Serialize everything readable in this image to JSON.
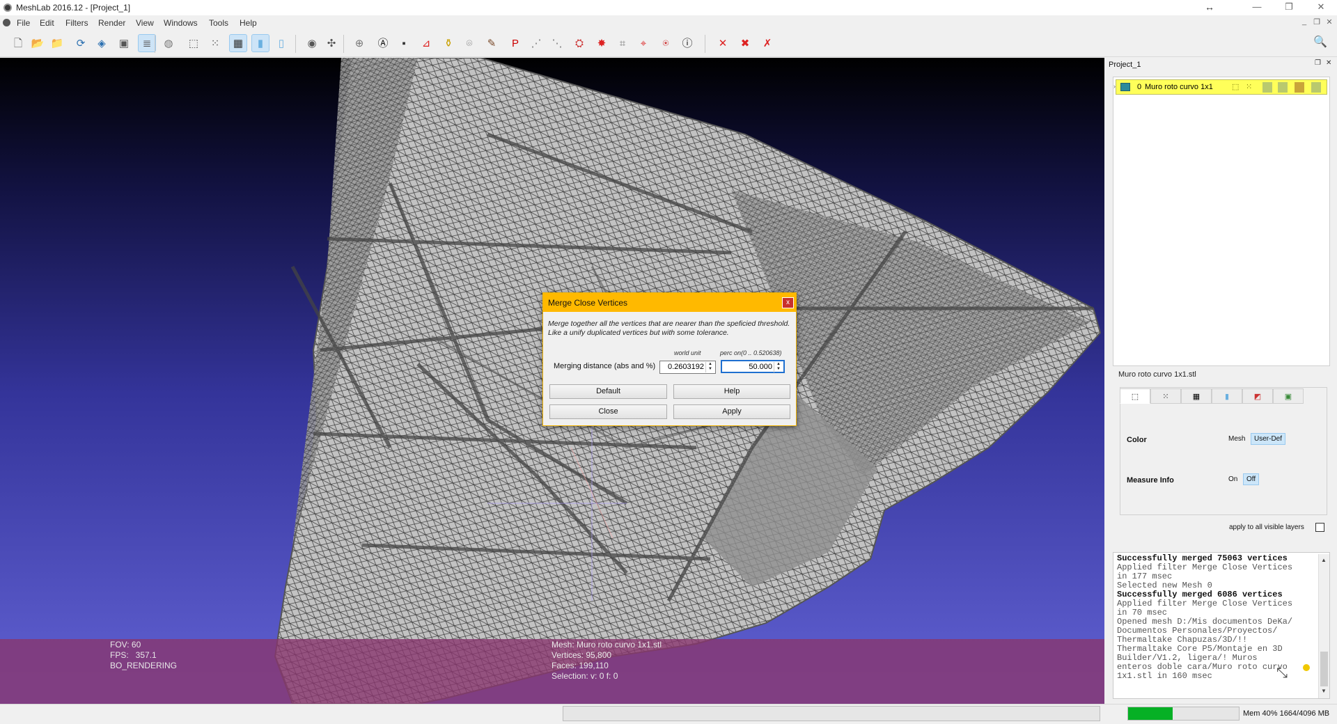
{
  "window": {
    "title": "MeshLab 2016.12 - [Project_1]",
    "controls": {
      "minimize": "—",
      "restore": "❐",
      "close": "✕"
    },
    "mdi_controls": {
      "minimize": "_",
      "restore": "❐",
      "close": "✕"
    }
  },
  "menu": [
    "File",
    "Edit",
    "Filters",
    "Render",
    "View",
    "Windows",
    "Tools",
    "Help"
  ],
  "toolbar": {
    "icons": [
      {
        "name": "new-project-icon",
        "glyph": "🗋",
        "active": false
      },
      {
        "name": "open-project-icon",
        "glyph": "📂",
        "active": false
      },
      {
        "name": "import-mesh-icon",
        "glyph": "📁",
        "active": false
      },
      {
        "name": "reload-icon",
        "glyph": "⟳",
        "active": false
      },
      {
        "name": "export-mesh-icon",
        "glyph": "◈",
        "active": false
      },
      {
        "name": "snapshot-icon",
        "glyph": "▣",
        "active": false
      },
      {
        "name": "layers-icon",
        "glyph": "≣",
        "active": true
      },
      {
        "name": "raster-icon",
        "glyph": "◍",
        "active": false
      },
      {
        "name": "bbox-icon",
        "glyph": "⬚",
        "active": false
      },
      {
        "name": "points-icon",
        "glyph": "⁙",
        "active": false
      },
      {
        "name": "wireframe-icon",
        "glyph": "▦",
        "active": true
      },
      {
        "name": "flat-icon",
        "glyph": "▮",
        "active": true
      },
      {
        "name": "smooth-icon",
        "glyph": "▯",
        "active": false
      },
      {
        "name": "light-icon",
        "glyph": "◉",
        "active": false
      },
      {
        "name": "trackball-icon",
        "glyph": "✣",
        "active": false
      },
      {
        "name": "manipulator-icon",
        "glyph": "⊕",
        "active": false
      },
      {
        "name": "annotation-icon",
        "glyph": "Ⓐ",
        "active": false
      },
      {
        "name": "measure-icon",
        "glyph": "▪",
        "active": false
      },
      {
        "name": "align-icon",
        "glyph": "⊿",
        "active": false
      },
      {
        "name": "paint-icon",
        "glyph": "⚱",
        "active": false
      },
      {
        "name": "camera-icon",
        "glyph": "⌾",
        "active": false
      },
      {
        "name": "brush-icon",
        "glyph": "✎",
        "active": false
      },
      {
        "name": "pickpoints-icon",
        "glyph": "P",
        "active": false
      },
      {
        "name": "select-vertices-icon",
        "glyph": "⋰",
        "active": false
      },
      {
        "name": "select-faces-icon",
        "glyph": "⋱",
        "active": false
      },
      {
        "name": "georef-icon",
        "glyph": "⛭",
        "active": false
      },
      {
        "name": "star-select-icon",
        "glyph": "✸",
        "active": false
      },
      {
        "name": "select-connected-icon",
        "glyph": "⌗",
        "active": false
      },
      {
        "name": "select-area-icon",
        "glyph": "⌖",
        "active": false
      },
      {
        "name": "select-zone-icon",
        "glyph": "⍟",
        "active": false
      },
      {
        "name": "info-icon",
        "glyph": "ⓘ",
        "active": false
      },
      {
        "name": "delete-vertices-icon",
        "glyph": "✕",
        "active": false
      },
      {
        "name": "delete-faces-icon",
        "glyph": "✖",
        "active": false
      },
      {
        "name": "delete-all-icon",
        "glyph": "✗",
        "active": false
      }
    ],
    "search_icon": "🔍"
  },
  "viewport": {
    "hud_left": [
      "FOV: 60",
      "FPS:   357.1",
      "BO_RENDERING"
    ],
    "hud_mesh": [
      "Mesh: Muro roto curvo 1x1.stl",
      "Vertices: 95,800",
      "Faces: 199,110",
      "Selection: v: 0 f: 0"
    ]
  },
  "dialog": {
    "title": "Merge Close Vertices",
    "close_glyph": "x",
    "description": "Merge together all the vertices that are nearer than the speficied threshold. Like a unify duplicated vertices but with some tolerance.",
    "param_label": "Merging distance (abs and %)",
    "col_world": "world unit",
    "col_perc": "perc on(0 .. 0.520638)",
    "abs_value": "0.2603192",
    "perc_value": "50.000",
    "buttons": {
      "default": "Default",
      "help": "Help",
      "close": "Close",
      "apply": "Apply"
    }
  },
  "dock": {
    "title": "Project_1",
    "layer": {
      "index": "0",
      "name": "Muro roto curvo 1x1"
    },
    "mesh_label": "Muro roto curvo 1x1.stl",
    "decorators": {
      "color_label": "Color",
      "color_options": [
        "Mesh",
        "User-Def"
      ],
      "color_selected": "User-Def",
      "measure_label": "Measure Info",
      "measure_options": [
        "On",
        "Off"
      ],
      "measure_selected": "Off"
    },
    "apply_all_label": "apply to all visible layers"
  },
  "log": [
    {
      "text": "Successfully merged 75063 vertices",
      "bold": true
    },
    {
      "text": "Applied filter Merge Close Vertices",
      "bold": false
    },
    {
      "text": "in 177 msec",
      "bold": false
    },
    {
      "text": "Selected new Mesh 0",
      "bold": false
    },
    {
      "text": "Successfully merged 6086 vertices",
      "bold": true
    },
    {
      "text": "Applied filter Merge Close Vertices",
      "bold": false
    },
    {
      "text": "in 70 msec",
      "bold": false
    },
    {
      "text": "Opened mesh D:/Mis documentos DeKa/",
      "bold": false
    },
    {
      "text": "Documentos Personales/Proyectos/",
      "bold": false
    },
    {
      "text": "Thermaltake Chapuzas/3D/!!",
      "bold": false
    },
    {
      "text": "Thermaltake Core P5/Montaje en 3D",
      "bold": false
    },
    {
      "text": "Builder/V1.2, ligera/! Muros",
      "bold": false
    },
    {
      "text": "enteros doble cara/Muro roto curvo",
      "bold": false
    },
    {
      "text": "1x1.stl in 160 msec",
      "bold": false
    }
  ],
  "status": {
    "memory_text": "Mem 40% 1664/4096 MB",
    "memory_percent": 40
  }
}
